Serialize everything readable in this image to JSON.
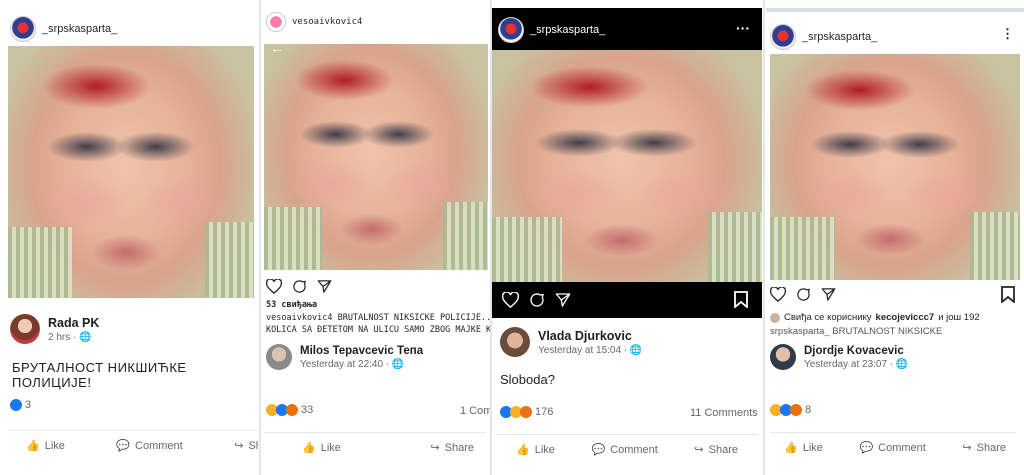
{
  "panel1": {
    "username": "_srpskasparta_",
    "fb_name": "Rada PK",
    "fb_time": "2 hrs",
    "post_text": "БРУТАЛНОСТ НИКШИЋКЕ ПОЛИЦИЈЕ!",
    "reaction_count": "3",
    "like_label": "Like",
    "comment_label": "Comment",
    "share_label": "Sha"
  },
  "panel2": {
    "username": "vesoaivkovic4",
    "likes": "53 свиђања",
    "caption_line1": "vesoaivkovic4 BRUTALNOST NIKSICKE POLICIJE.....GURN",
    "caption_line2": "KOLICA SA ĐETETOM NA ULICU SAMO ZBOG MAJKE KOJA",
    "fb_name": "Milos Tepavcevic Тепа",
    "fb_time": "Yesterday at 22:40",
    "reaction_count": "33",
    "comments": "1 Com",
    "like_label": "Like",
    "share_label": "Share"
  },
  "panel3": {
    "username": "_srpskasparta_",
    "fb_name": "Vlada Djurkovic",
    "fb_time": "Yesterday at 15:04",
    "post_text": "Sloboda?",
    "reaction_count": "176",
    "comments": "11 Comments",
    "like_label": "Like",
    "comment_label": "Comment",
    "share_label": "Share"
  },
  "panel4": {
    "username": "_srpskasparta_",
    "liked_by_prefix": "Свиђа се кориснику",
    "liked_by_user": "kecojeviccc7",
    "liked_by_suffix": "и још 192",
    "caption_partial": "srpskasparta_ BRUTALNOST NIKSICKE",
    "fb_name": "Djordje Kovacevic",
    "fb_time": "Yesterday at 23:07",
    "reaction_count": "8",
    "like_label": "Like",
    "comment_label": "Comment",
    "share_label": "Share"
  },
  "colors": {
    "fb_blue": "#1877f2",
    "meta_gray": "#65676b",
    "divider": "#e4e6eb"
  },
  "icons": [
    "heart-icon",
    "comment-icon",
    "send-icon",
    "bookmark-icon",
    "globe-icon",
    "thumbs-up-icon",
    "share-icon",
    "back-arrow-icon",
    "more-icon"
  ]
}
